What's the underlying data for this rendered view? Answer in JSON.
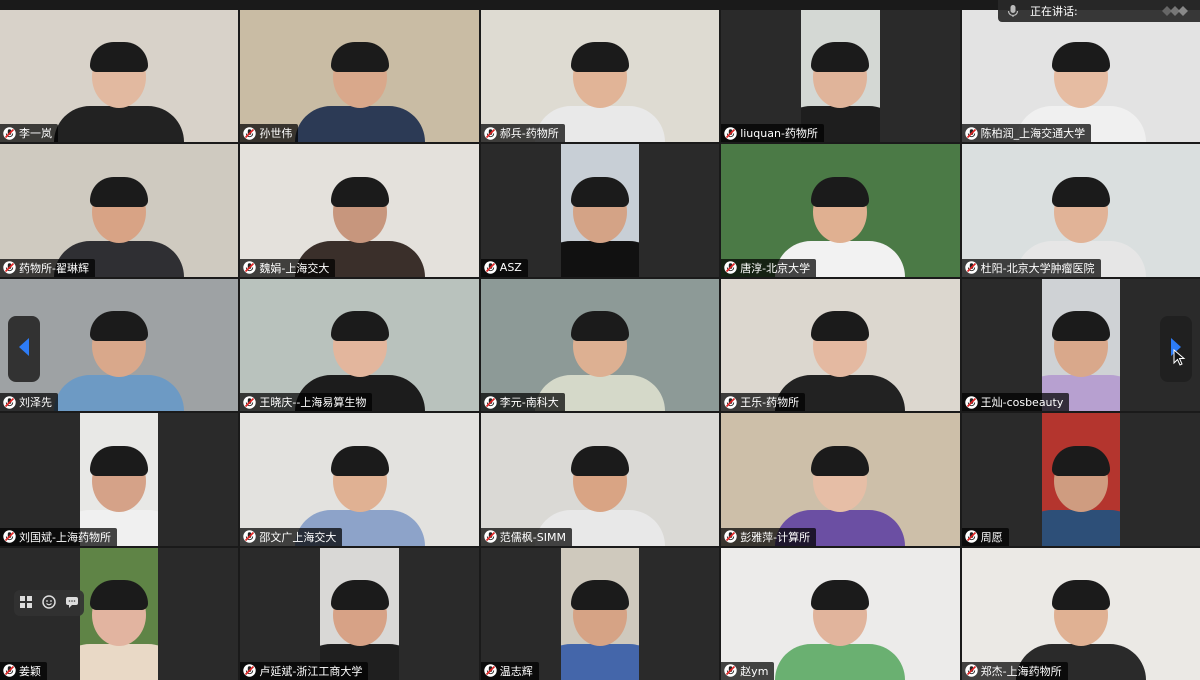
{
  "top_bar": {
    "speaking_label": "正在讲话:"
  },
  "participants": [
    {
      "name": "李一岚",
      "bg": "#d8d2c9",
      "skin": "#e2b9a0",
      "shirt": "#222"
    },
    {
      "name": "孙世伟",
      "bg": "#c9bca4",
      "skin": "#d9a88b",
      "shirt": "#2c3a55"
    },
    {
      "name": "郝兵-药物所",
      "bg": "#dedbd2",
      "skin": "#e1b497",
      "shirt": "#e9e9e9"
    },
    {
      "name": "liuquan-药物所",
      "bg": "#d4d8d4",
      "skin": "#e0b49a",
      "shirt": "#1e1e1e"
    },
    {
      "name": "陈柏润_上海交通大学",
      "bg": "#e3e3e3",
      "skin": "#e6bca2",
      "shirt": "#f0f0f0"
    },
    {
      "name": "药物所-翟琳辉",
      "bg": "#cfcac0",
      "skin": "#d8a385",
      "shirt": "#2f2f33"
    },
    {
      "name": "魏娟-上海交大",
      "bg": "#e4e1dc",
      "skin": "#c7967d",
      "shirt": "#3a2f2a"
    },
    {
      "name": "ASZ",
      "bg": "#c8cfd6",
      "skin": "#d4a386",
      "shirt": "#111"
    },
    {
      "name": "唐淳-北京大学",
      "bg": "#4b7a46",
      "skin": "#e0b091",
      "shirt": "#f2f2f2"
    },
    {
      "name": "杜阳-北京大学肿瘤医院",
      "bg": "#dadfdf",
      "skin": "#e1b397",
      "shirt": "#e6e6e6"
    },
    {
      "name": "刘泽先",
      "bg": "#9ea2a4",
      "skin": "#d9a88b",
      "shirt": "#6d9ac4"
    },
    {
      "name": "王晓庆--上海易算生物",
      "bg": "#b9c2bd",
      "skin": "#e3b69d",
      "shirt": "#1c1c1c"
    },
    {
      "name": "李元-南科大",
      "bg": "#8d9a97",
      "skin": "#ddb092",
      "shirt": "#d5d9c9"
    },
    {
      "name": "王乐-药物所",
      "bg": "#dcd7cf",
      "skin": "#e4b9a1",
      "shirt": "#222"
    },
    {
      "name": "王灿-cosbeauty",
      "bg": "#cfd2d5",
      "skin": "#d9a88b",
      "shirt": "#b7a0d0"
    },
    {
      "name": "刘国斌-上海药物所",
      "bg": "#e8e8e6",
      "skin": "#d5a288",
      "shirt": "#f0f0f0"
    },
    {
      "name": "邵文广上海交大",
      "bg": "#e3e2df",
      "skin": "#e0b193",
      "shirt": "#8da3c9"
    },
    {
      "name": "范儒枫-SIMM",
      "bg": "#dad9d5",
      "skin": "#d9a484",
      "shirt": "#e8e8e8"
    },
    {
      "name": "彭雅萍-计算所",
      "bg": "#cdbfa9",
      "skin": "#e6bea6",
      "shirt": "#6b4fa3"
    },
    {
      "name": "周愿",
      "bg": "#b4352e",
      "skin": "#cf9c80",
      "shirt": "#2d4f78"
    },
    {
      "name": "姜颖",
      "bg": "#5f8446",
      "skin": "#e2b4a0",
      "shirt": "#e9d9c6"
    },
    {
      "name": "卢延斌-浙江工商大学",
      "bg": "#d9d8d6",
      "skin": "#d7a286",
      "shirt": "#1f1f1f"
    },
    {
      "name": "温志辉",
      "bg": "#cfc9bd",
      "skin": "#d6a385",
      "shirt": "#4466aa"
    },
    {
      "name": "赵ym",
      "bg": "#ecebea",
      "skin": "#e1b49c",
      "shirt": "#6ab071"
    },
    {
      "name": "郑杰-上海药物所",
      "bg": "#ebe9e5",
      "skin": "#e0b193",
      "shirt": "#2a2a2a"
    }
  ]
}
